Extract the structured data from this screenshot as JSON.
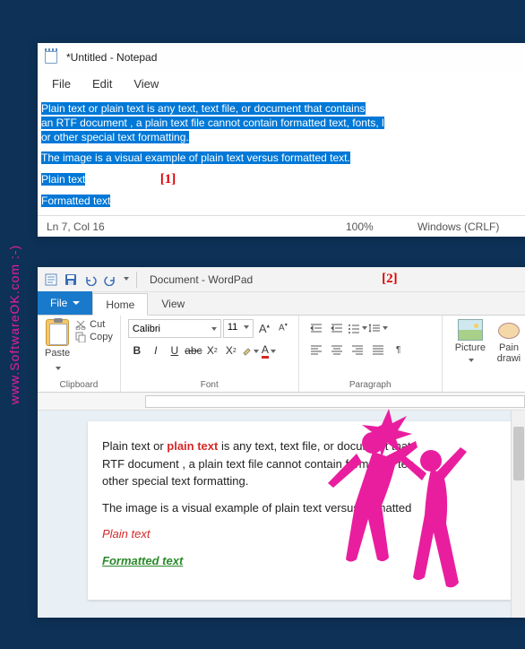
{
  "watermark": "www.SoftwareOK.com  :-)",
  "notepad": {
    "title": "*Untitled - Notepad",
    "menu": {
      "file": "File",
      "edit": "Edit",
      "view": "View"
    },
    "lines": {
      "l1a": "Plain text or plain text is any text, text file, or document that contains",
      "l1b": "an RTF document , a plain text file cannot contain formatted text, fonts, l",
      "l1c": "or other special text formatting.",
      "l2": "The image is a visual example of plain text versus formatted text.",
      "l3": "Plain text",
      "l4": "Formatted text"
    },
    "annotation": "[1]",
    "status": {
      "pos": "Ln 7, Col 16",
      "zoom": "100%",
      "eol": "Windows (CRLF)"
    }
  },
  "wordpad": {
    "qat_title": "Document - WordPad",
    "annotation": "[2]",
    "tabs": {
      "file": "File",
      "home": "Home",
      "view": "View"
    },
    "clipboard": {
      "paste": "Paste",
      "cut": "Cut",
      "copy": "Copy",
      "group": "Clipboard"
    },
    "font": {
      "name": "Calibri",
      "size": "11",
      "grow": "A",
      "shrink": "A",
      "group": "Font"
    },
    "paragraph": {
      "group": "Paragraph"
    },
    "insert": {
      "picture": "Picture",
      "paint": "Pain drawi"
    },
    "doc": {
      "p1a": "Plain text or ",
      "p1b": "plain text",
      "p1c": " is any text, text file, or document that",
      "p1d": "RTF document , a plain text file cannot contain formatted tex",
      "p1e": "other special text formatting.",
      "p2": "The image is a visual example of plain text versus formatted ",
      "p3": "Plain text",
      "p4": "Formatted text"
    }
  }
}
